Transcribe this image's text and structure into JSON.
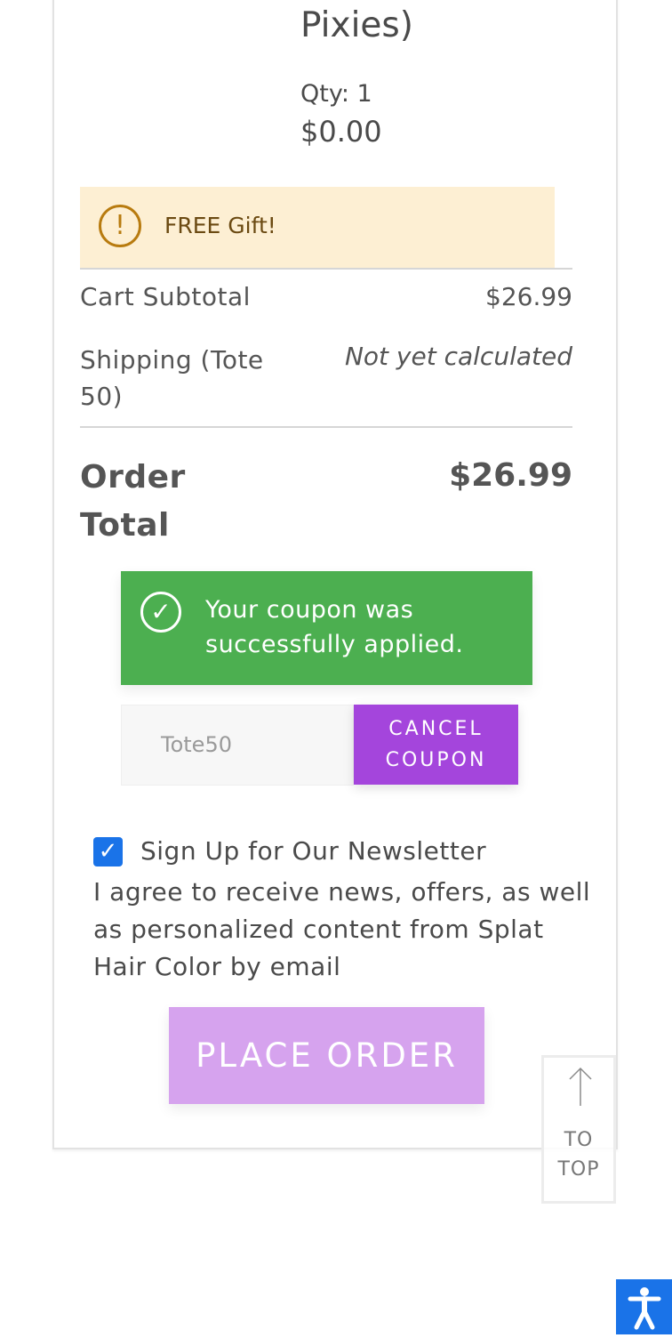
{
  "product": {
    "name_tail": "Pixies)",
    "qty": "Qty: 1",
    "price": "$0.00"
  },
  "gift_notice": {
    "icon": "alert-circle-icon",
    "text": "FREE Gift!"
  },
  "totals": {
    "subtotal_label": "Cart Subtotal",
    "subtotal_value": "$26.99",
    "shipping_label_line1": "Shipping (Tote",
    "shipping_label_line2": "50)",
    "shipping_value": "Not yet calculated",
    "order_total_label_line1": "Order",
    "order_total_label_line2": "Total",
    "order_total_value": "$26.99"
  },
  "coupon": {
    "success_line1": "Your coupon was",
    "success_line2": "successfully applied.",
    "code": "Tote50",
    "cancel_line1": "CANCEL",
    "cancel_line2": "COUPON"
  },
  "newsletter": {
    "checked": true,
    "title": "Sign Up for Our Newsletter",
    "body": "I agree to receive news, offers, as well as personalized content from Splat Hair Color by email"
  },
  "actions": {
    "place_order": "PLACE ORDER",
    "to_top_line1": "TO",
    "to_top_line2": "TOP"
  },
  "colors": {
    "success": "#4caf50",
    "accent": "#a445dc",
    "place_order_bg": "#d6a3ee",
    "notice_bg": "#fdefd3",
    "a11y_blue": "#1a73e8"
  }
}
